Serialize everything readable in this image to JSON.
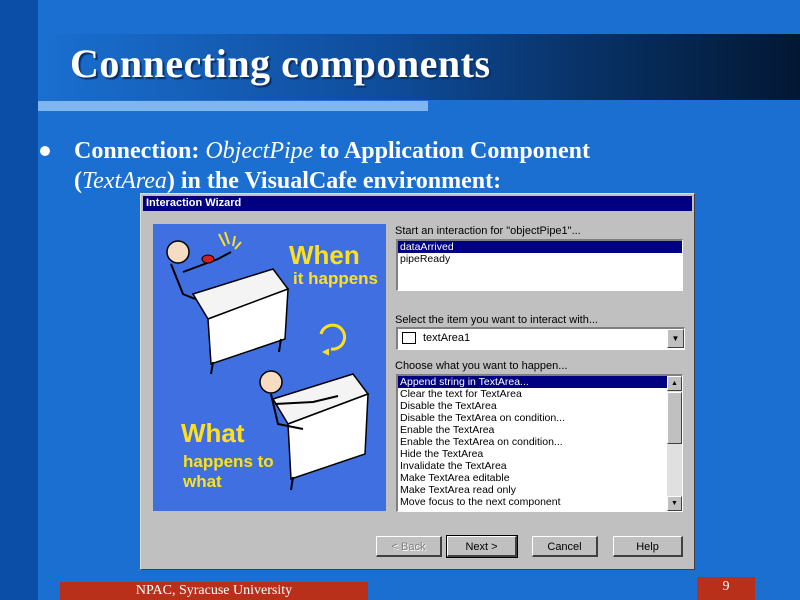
{
  "slide": {
    "title": "Connecting components",
    "bullet": {
      "prefix": "Connection: ",
      "italic1": "ObjectPipe",
      "mid": " to Application Component (",
      "italic2": "TextArea",
      "suffix": ") in the VisualCafe environment:"
    },
    "footer": "NPAC, Syracuse University",
    "page_number": "9"
  },
  "dialog": {
    "title": "Interaction Wizard",
    "art": {
      "when": "When",
      "it_happens": "it happens",
      "what": "What",
      "happens_to": "happens to",
      "what2": "what"
    },
    "start_label": "Start an interaction for \"objectPipe1\"...",
    "events": [
      "dataArrived",
      "pipeReady"
    ],
    "events_selected": 0,
    "select_item_label": "Select the item you want to interact with...",
    "item_value": "textArea1",
    "choose_label": "Choose what you want to happen...",
    "actions": [
      "Append string in TextArea...",
      "Clear the text for TextArea",
      "Disable the TextArea",
      "Disable the TextArea on condition...",
      "Enable the TextArea",
      "Enable the TextArea on condition...",
      "Hide the TextArea",
      "Invalidate the TextArea",
      "Make TextArea editable",
      "Make TextArea read only",
      "Move focus to the next component"
    ],
    "actions_selected": 0,
    "buttons": {
      "back": "< Back",
      "next": "Next >",
      "cancel": "Cancel",
      "help": "Help"
    }
  },
  "colors": {
    "background": "#1a6fd0",
    "title_band_dark": "#031733",
    "selection": "#000080",
    "footer_box": "#b8301a"
  }
}
